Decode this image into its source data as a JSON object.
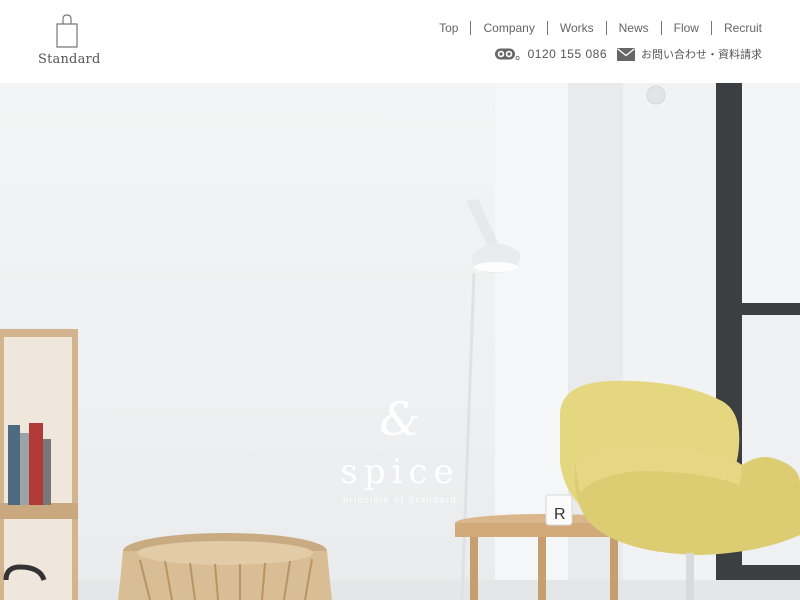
{
  "header": {
    "logo_text": "Standard",
    "nav": [
      {
        "label": "Top"
      },
      {
        "label": "Company"
      },
      {
        "label": "Works"
      },
      {
        "label": "News"
      },
      {
        "label": "Flow"
      },
      {
        "label": "Recruit"
      }
    ],
    "contact": {
      "tel_icon": "free-dial-icon",
      "tel_number": "0120 155 086",
      "mail_icon": "mail-icon",
      "request_label": "お問い合わせ・資料請求"
    }
  },
  "hero": {
    "ampersand": "&",
    "word": "spice",
    "subtitle": "principle of Standard"
  }
}
